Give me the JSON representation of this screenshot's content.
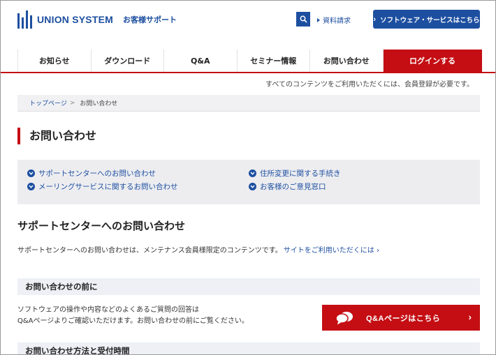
{
  "header": {
    "logo_text": "UNION SYSTEM",
    "logo_sub": "お客様サポート",
    "doc_request": "資料請求",
    "software_button": "ソフトウェア・サービスはこちら",
    "brand_color": "#1d4fa0"
  },
  "nav": {
    "items": [
      "お知らせ",
      "ダウンロード",
      "Q&A",
      "セミナー情報",
      "お問い合わせ"
    ],
    "login": "ログインする",
    "accent_color": "#c40e14"
  },
  "notice": "すべてのコンテンツをご利用いただくには、会員登録が必要です。",
  "breadcrumb": {
    "top": "トップページ",
    "separator": ">",
    "current": "お問い合わせ"
  },
  "page_title": "お問い合わせ",
  "anchors": [
    "サポートセンターへのお問い合わせ",
    "メーリングサービスに関するお問い合わせ",
    "住所変更に関する手続き",
    "お客様のご意見窓口"
  ],
  "support_section": {
    "title": "サポートセンターへのお問い合わせ",
    "desc": "サポートセンターへのお問い合わせは、メンテナンス会員様限定のコンテンツです。",
    "site_link": "サイトをご利用いただくには ›"
  },
  "before_section": {
    "title": "お問い合わせの前に",
    "line1": "ソフトウェアの操作や内容などのよくあるご質問の回答は",
    "line2": "Q&Aページよりご確認いただけます。お問い合わせの前にご覧ください。",
    "qa_button": "Q&Aページはこちら"
  },
  "method_section": {
    "title": "お問い合わせ方法と受付時間"
  }
}
